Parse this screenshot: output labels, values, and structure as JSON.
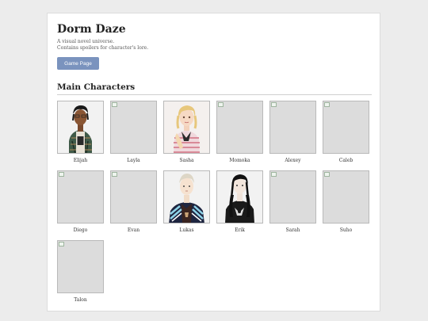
{
  "header": {
    "title": "Dorm Daze",
    "subtitle_lines": [
      "A visual novel universe.",
      "Contains spoilers for character's lore."
    ],
    "game_button_label": "Game Page"
  },
  "section": {
    "title": "Main Characters"
  },
  "characters": [
    {
      "name": "Elijah",
      "image": "elijah-portrait"
    },
    {
      "name": "Layla",
      "image": "broken-image"
    },
    {
      "name": "Sasha",
      "image": "sasha-portrait"
    },
    {
      "name": "Momoka",
      "image": "broken-image"
    },
    {
      "name": "Alexey",
      "image": "broken-image"
    },
    {
      "name": "Caleb",
      "image": "broken-image"
    },
    {
      "name": "Diego",
      "image": "broken-image"
    },
    {
      "name": "Evan",
      "image": "broken-image"
    },
    {
      "name": "Lukas",
      "image": "lukas-portrait"
    },
    {
      "name": "Erik",
      "image": "erik-portrait"
    },
    {
      "name": "Sarah",
      "image": "broken-image"
    },
    {
      "name": "Suho",
      "image": "broken-image"
    },
    {
      "name": "Talon",
      "image": "broken-image"
    }
  ],
  "colors": {
    "button": "#7a93be",
    "placeholder": "#dcdcdc"
  }
}
